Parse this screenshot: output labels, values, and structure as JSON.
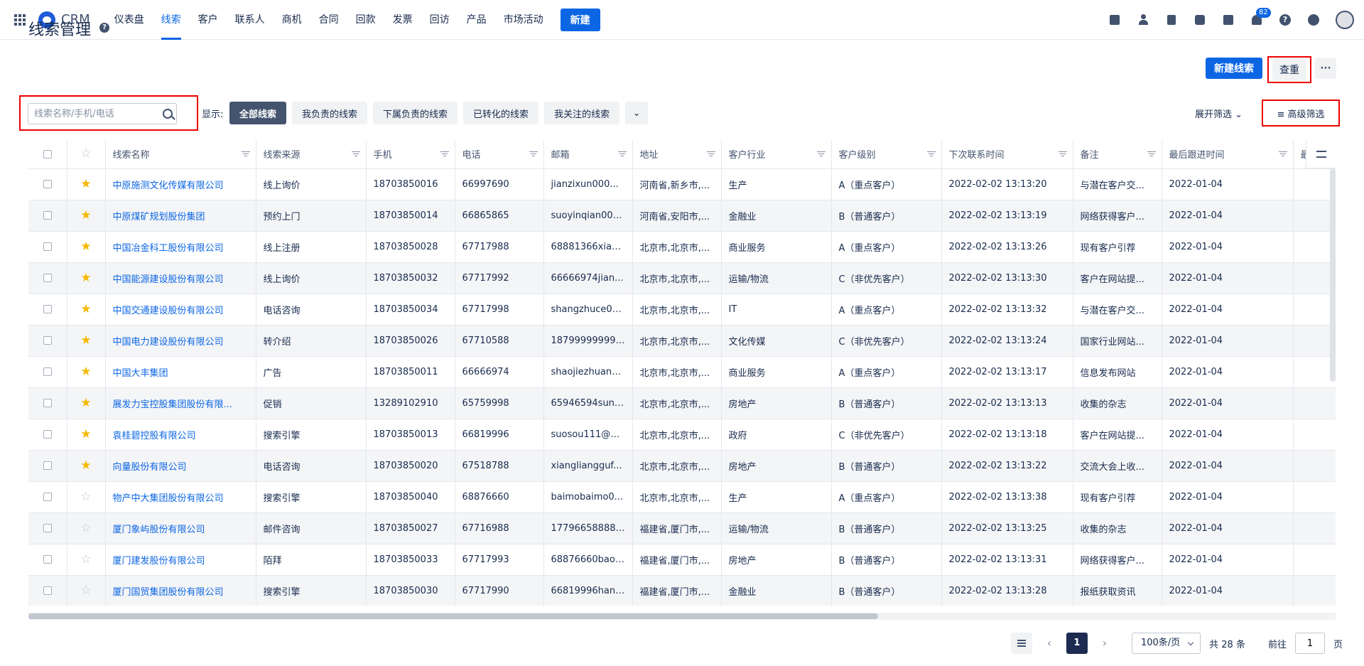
{
  "app": {
    "name": "CRM"
  },
  "nav": {
    "items": [
      "仪表盘",
      "线索",
      "客户",
      "联系人",
      "商机",
      "合同",
      "回款",
      "发票",
      "回访",
      "产品",
      "市场活动"
    ],
    "active_index": 1,
    "new_label": "新建",
    "notification_count": "82",
    "help_glyph": "?"
  },
  "page": {
    "title": "线索管理",
    "help_glyph": "?",
    "new_lead_label": "新建线索",
    "reset_label": "查重",
    "more_label": "···"
  },
  "filters": {
    "search_placeholder": "线索名称/手机/电话",
    "show_label": "显示:",
    "scopes": [
      "全部线索",
      "我负责的线索",
      "下属负责的线索",
      "已转化的线索",
      "我关注的线索"
    ],
    "active_scope": 0,
    "more_scope_glyph": "⌄",
    "expand_label": "展开筛选 ⌄",
    "advanced_label": "≡ 高级筛选"
  },
  "table": {
    "columns": [
      "线索名称",
      "线索来源",
      "手机",
      "电话",
      "邮箱",
      "地址",
      "客户行业",
      "客户级别",
      "下次联系时间",
      "备注",
      "最后跟进时间",
      "最"
    ],
    "rows": [
      {
        "starred": true,
        "cells": [
          "中原施测文化传媒有限公司",
          "线上询价",
          "18703850016",
          "66997690",
          "jianzixun000...",
          "河南省,新乡市,...",
          "生产",
          "A（重点客户）",
          "2022-02-02 13:13:20",
          "与潜在客户交...",
          "2022-01-04"
        ]
      },
      {
        "starred": true,
        "cells": [
          "中原煤矿规划股份集团",
          "预约上门",
          "18703850014",
          "66865865",
          "suoyinqian000...",
          "河南省,安阳市,...",
          "金融业",
          "B（普通客户）",
          "2022-02-02 13:13:19",
          "网络获得客户...",
          "2022-01-04"
        ]
      },
      {
        "starred": true,
        "cells": [
          "中国冶金科工股份有限公司",
          "线上注册",
          "18703850028",
          "67717988",
          "68881366xian...",
          "北京市,北京市,...",
          "商业服务",
          "A（重点客户）",
          "2022-02-02 13:13:26",
          "现有客户引荐",
          "2022-01-04"
        ]
      },
      {
        "starred": true,
        "cells": [
          "中国能源建设股份有限公司",
          "线上询价",
          "18703850032",
          "67717992",
          "66666974jian...",
          "北京市,北京市,...",
          "运输/物流",
          "C（非优先客户）",
          "2022-02-02 13:13:30",
          "客户在网站提...",
          "2022-01-04"
        ]
      },
      {
        "starred": true,
        "cells": [
          "中国交通建设股份有限公司",
          "电话咨询",
          "18703850034",
          "67717998",
          "shangzhuce00...",
          "北京市,北京市,...",
          "IT",
          "A（重点客户）",
          "2022-02-02 13:13:32",
          "与潜在客户交...",
          "2022-01-04"
        ]
      },
      {
        "starred": true,
        "cells": [
          "中国电力建设股份有限公司",
          "转介绍",
          "18703850026",
          "67710588",
          "18799999999z...",
          "北京市,北京市,...",
          "文化传媒",
          "C（非优先客户）",
          "2022-02-02 13:13:24",
          "国家行业网站...",
          "2022-01-04"
        ]
      },
      {
        "starred": true,
        "cells": [
          "中国大丰集团",
          "广告",
          "18703850011",
          "66666974",
          "shaojiezhuan0...",
          "北京市,北京市,...",
          "商业服务",
          "A（重点客户）",
          "2022-02-02 13:13:17",
          "信息发布网站",
          "2022-01-04"
        ]
      },
      {
        "starred": true,
        "cells": [
          "展发力宝控股集团股份有限...",
          "促销",
          "13289102910",
          "65759998",
          "65946594suni...",
          "北京市,北京市,...",
          "房地产",
          "B（普通客户）",
          "2022-02-02 13:13:13",
          "收集的杂志",
          "2022-01-04"
        ]
      },
      {
        "starred": true,
        "cells": [
          "袁桂碧控股有限公司",
          "搜索引擎",
          "18703850013",
          "66819996",
          "suosou111@g...",
          "北京市,北京市,...",
          "政府",
          "C（非优先客户）",
          "2022-02-02 13:13:18",
          "客户在网站提...",
          "2022-01-04"
        ]
      },
      {
        "starred": true,
        "cells": [
          "向量股份有限公司",
          "电话咨询",
          "18703850020",
          "67518788",
          "xiangliangguf...",
          "北京市,北京市,...",
          "房地产",
          "B（普通客户）",
          "2022-02-02 13:13:22",
          "交流大会上收...",
          "2022-01-04"
        ]
      },
      {
        "starred": false,
        "cells": [
          "物产中大集团股份有限公司",
          "搜索引擎",
          "18703850040",
          "68876660",
          "baimobaimo0...",
          "北京市,北京市,...",
          "生产",
          "A（重点客户）",
          "2022-02-02 13:13:38",
          "现有客户引荐",
          "2022-01-04"
        ]
      },
      {
        "starred": false,
        "cells": [
          "厦门象屿股份有限公司",
          "邮件咨询",
          "18703850027",
          "67716988",
          "17796658888d...",
          "福建省,厦门市,...",
          "运输/物流",
          "B（普通客户）",
          "2022-02-02 13:13:25",
          "收集的杂志",
          "2022-01-04"
        ]
      },
      {
        "starred": false,
        "cells": [
          "厦门建发股份有限公司",
          "陌拜",
          "18703850033",
          "67717993",
          "68876660baol...",
          "福建省,厦门市,...",
          "房地产",
          "B（普通客户）",
          "2022-02-02 13:13:31",
          "网络获得客户...",
          "2022-01-04"
        ]
      },
      {
        "starred": false,
        "cells": [
          "厦门国贸集团股份有限公司",
          "搜索引擎",
          "18703850030",
          "67717990",
          "66819996hang...",
          "福建省,厦门市,...",
          "金融业",
          "B（普通客户）",
          "2022-02-02 13:13:28",
          "报纸获取资讯",
          "2022-01-04"
        ]
      }
    ]
  },
  "pagination": {
    "prev": "‹",
    "current_page": "1",
    "next": "›",
    "page_size": "100条/页",
    "total": "共 28 条",
    "goto_label": "前往",
    "goto_value": "1",
    "page_suffix": "页"
  },
  "colors": {
    "primary": "#0c66e4",
    "star": "#f5b800",
    "highlight": "#ee0000"
  }
}
